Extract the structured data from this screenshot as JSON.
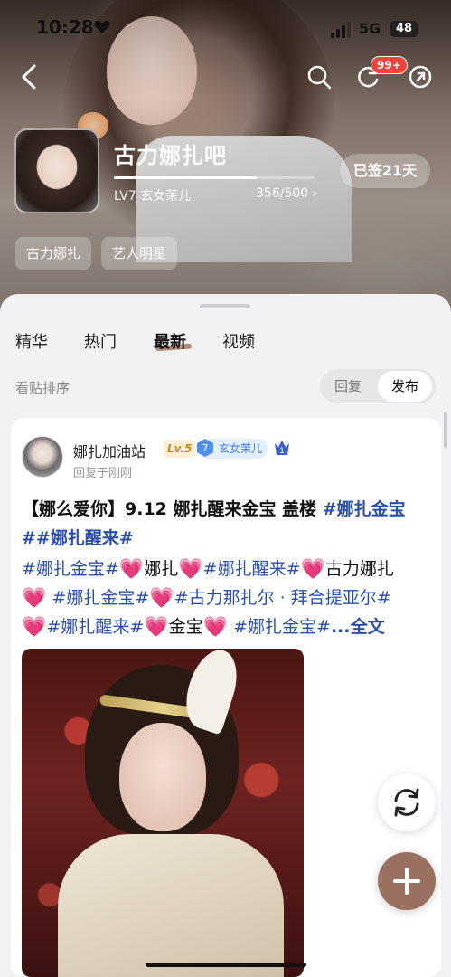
{
  "status_bar": {
    "time": "10:28",
    "network": "5G",
    "battery": "48"
  },
  "nav": {
    "notification_count": "99+"
  },
  "forum": {
    "name": "古力娜扎吧",
    "level": "LV7 玄女茉儿",
    "progress_text": "356/500",
    "progress_fraction": 0.712,
    "signed_label": "已签21天",
    "tags": [
      "古力娜扎",
      "艺人明星"
    ]
  },
  "tabs": [
    "精华",
    "热门",
    "最新",
    "视频"
  ],
  "active_tab": "最新",
  "sort": {
    "label": "看贴排序",
    "reply": "回复",
    "publish": "发布",
    "selected": "发布"
  },
  "post": {
    "author": "娜扎加油站",
    "level_badge": "Lv.5",
    "fan_level": "7",
    "fan_title": "玄女茉儿",
    "rank": "1",
    "reply_time": "回复于刚刚",
    "title_text": "【娜么爱你】9.12 娜扎醒来金宝 盖楼 ",
    "title_topic1": "#娜扎金宝",
    "title_topic2": "##娜扎醒来#",
    "line3": {
      "t1": "#娜扎金宝#",
      "t2": "娜扎",
      "t3": "#娜扎醒来#",
      "t4": "古力娜扎"
    },
    "line4": {
      "t1": " #娜扎金宝#",
      "t2": "#古力那扎尔 · 拜合提亚尔#"
    },
    "line5": {
      "t1": "#娜扎醒来#",
      "t2": "金宝",
      "t3": " #娜扎金宝#",
      "t4": "...全文"
    },
    "heart": "💗"
  },
  "colors": {
    "topic": "#2a4fa8",
    "accent": "#9a7160",
    "badge": "#f0423a"
  },
  "icons": [
    "back-icon",
    "search-icon",
    "refresh-icon",
    "share-icon",
    "refresh-fab-icon",
    "add-fab-icon"
  ]
}
